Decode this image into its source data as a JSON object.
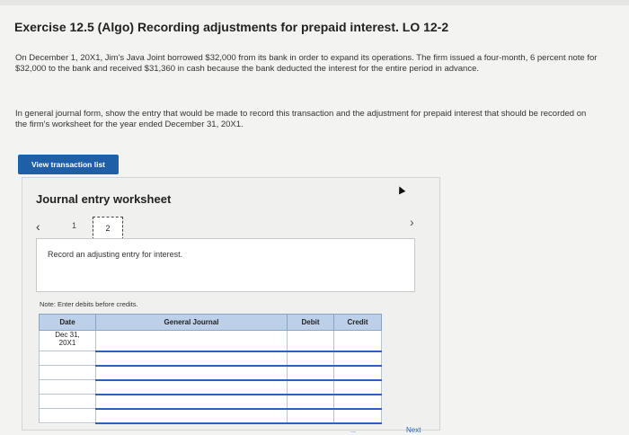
{
  "title": "Exercise 12.5 (Algo) Recording adjustments for prepaid interest. LO 12-2",
  "paragraph1": "On December 1, 20X1, Jim's Java Joint borrowed $32,000 from its bank in order to expand its operations. The firm issued a four-month, 6 percent note for $32,000 to the bank and received $31,360 in cash because the bank deducted the interest for the entire period in advance.",
  "paragraph2": "In general journal form, show the entry that would be made to record this transaction and the adjustment for prepaid interest that should be recorded on the firm's worksheet for the year ended December 31, 20X1.",
  "view_button": "View transaction list",
  "worksheet": {
    "title": "Journal entry worksheet",
    "prev_icon": "‹",
    "next_icon": "›",
    "tabs": [
      "1",
      "2"
    ],
    "instruction": "Record an adjusting entry for interest.",
    "note": "Note: Enter debits before credits."
  },
  "table": {
    "headers": [
      "Date",
      "General Journal",
      "Debit",
      "Credit"
    ],
    "first_date": "Dec 31, 20X1",
    "first_date_line1": "Dec 31,",
    "first_date_line2": "20X1"
  },
  "footer": {
    "more_icon": "...",
    "next_label": "Next"
  }
}
